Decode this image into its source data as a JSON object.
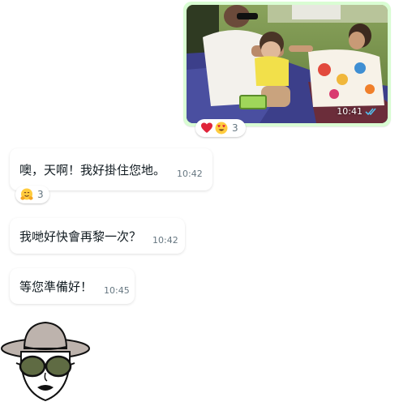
{
  "messages": [
    {
      "type": "image",
      "direction": "outgoing",
      "time": "10:41",
      "status_icon": "double-check-icon",
      "reaction": {
        "emojis": [
          "red-heart-icon",
          "heart-eyes-face-icon"
        ],
        "count": "3"
      }
    },
    {
      "type": "text",
      "direction": "incoming",
      "text": "噢，天啊！我好掛住您地。",
      "time": "10:42",
      "reaction": {
        "emojis": [
          "hugging-face-icon"
        ],
        "count": "3"
      }
    },
    {
      "type": "text",
      "direction": "incoming",
      "text": "我哋好快會再黎一次？",
      "time": "10:42"
    },
    {
      "type": "text",
      "direction": "incoming",
      "text": "等您準備好！",
      "time": "10:45"
    },
    {
      "type": "sticker",
      "direction": "incoming",
      "sticker": "woman-sunhat-sunglasses-sticker"
    }
  ],
  "colors": {
    "outgoing_bubble": "#d9fdd3",
    "incoming_bubble": "#ffffff",
    "text": "#111b21",
    "timestamp": "#667781",
    "read_ticks": "#53bdeb"
  }
}
